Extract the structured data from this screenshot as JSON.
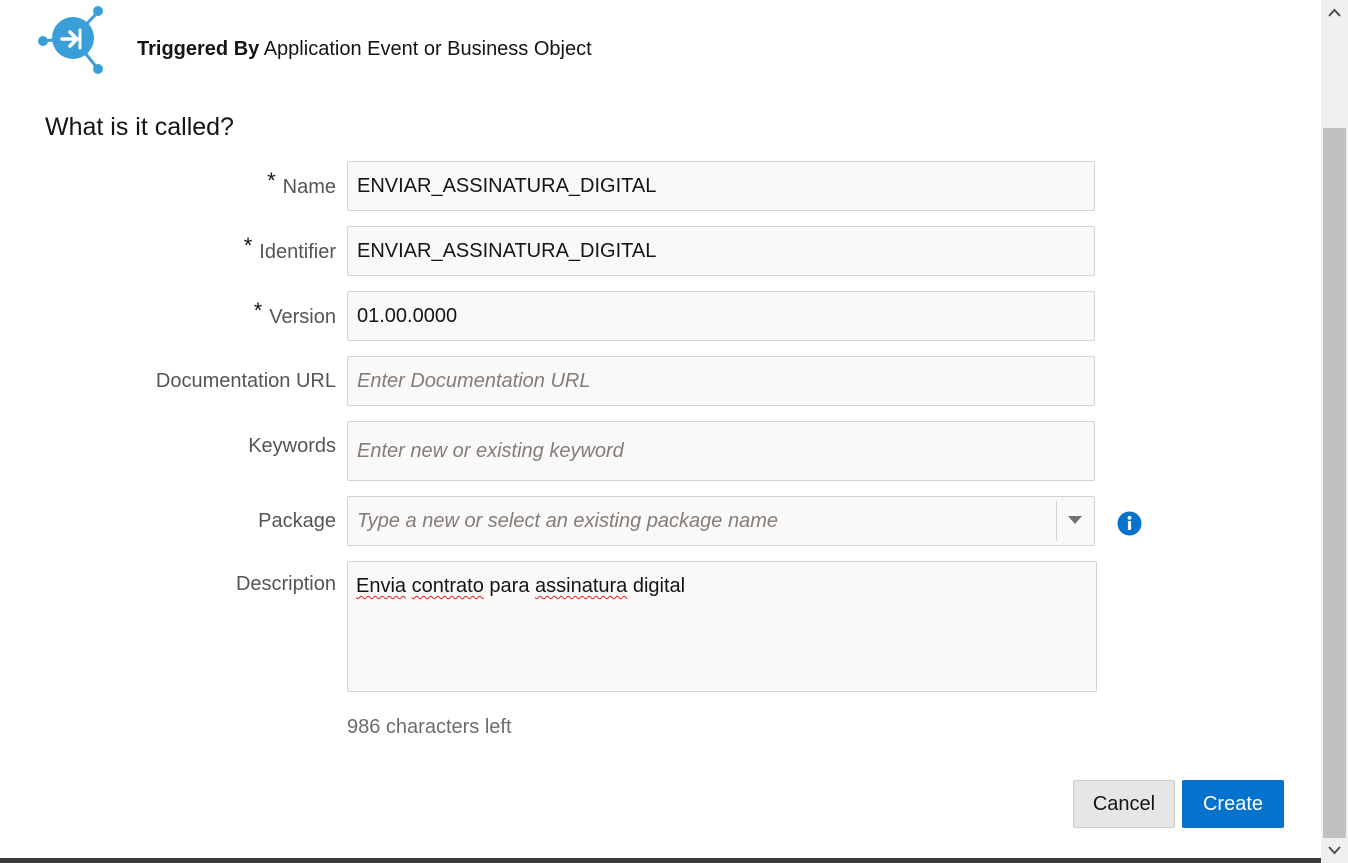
{
  "header": {
    "triggered_label": "Triggered By",
    "triggered_value": "Application Event or Business Object",
    "logo_icon": "integration-app-event-icon"
  },
  "form": {
    "title": "What is it called?",
    "required_marker": "*",
    "name": {
      "label": "Name",
      "value": "ENVIAR_ASSINATURA_DIGITAL"
    },
    "identifier": {
      "label": "Identifier",
      "value": "ENVIAR_ASSINATURA_DIGITAL"
    },
    "version": {
      "label": "Version",
      "value": "01.00.0000"
    },
    "documentation_url": {
      "label": "Documentation URL",
      "placeholder": "Enter Documentation URL"
    },
    "keywords": {
      "label": "Keywords",
      "placeholder": "Enter new or existing keyword"
    },
    "package": {
      "label": "Package",
      "placeholder": "Type a new or select an existing package name"
    },
    "description": {
      "label": "Description",
      "words": [
        "Envia",
        "contrato",
        "para",
        "assinatura",
        "digital"
      ],
      "chars_left": "986 characters left"
    }
  },
  "buttons": {
    "cancel": "Cancel",
    "create": "Create"
  },
  "colors": {
    "accent": "#0572ce",
    "logo": "#3a9fd8",
    "info_icon": "#0572ce"
  }
}
